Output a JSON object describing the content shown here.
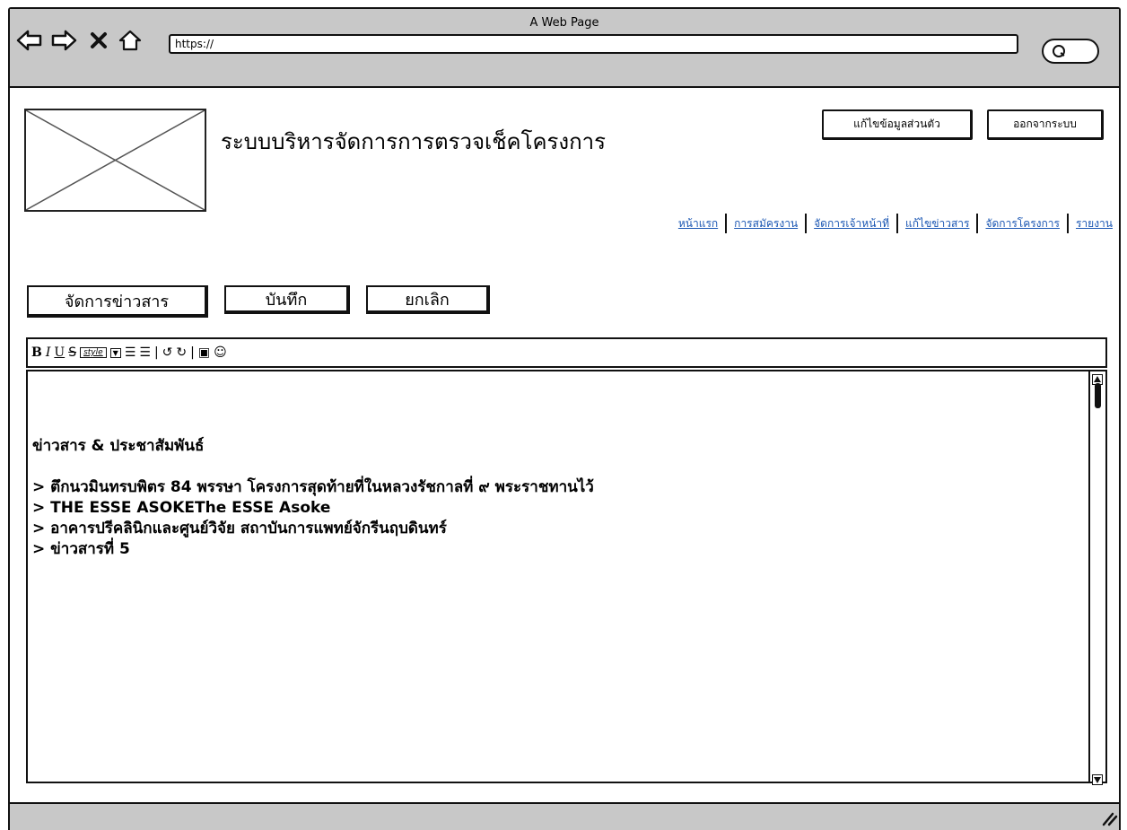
{
  "browser": {
    "window_title": "A Web Page",
    "url": "https://",
    "icons": [
      "back-arrow-icon",
      "forward-arrow-icon",
      "stop-icon",
      "home-icon",
      "search-icon"
    ]
  },
  "header": {
    "logo_placeholder": "image-placeholder",
    "title": "ระบบบริหารจัดการการตรวจเช็คโครงการ",
    "edit_profile_label": "แก้ไขข้อมูลส่วนตัว",
    "logout_label": "ออกจากระบบ"
  },
  "nav": {
    "items": [
      {
        "label": "หน้าแรก"
      },
      {
        "label": "การสมัครงาน"
      },
      {
        "label": "จัดการเจ้าหน้าที่"
      },
      {
        "label": "แก้ไขข่าวสาร"
      },
      {
        "label": "จัดการโครงการ"
      },
      {
        "label": "รายงาน"
      }
    ]
  },
  "actions": {
    "manage_news_label": "จัดการข่าวสาร",
    "save_label": "บันทึก",
    "cancel_label": "ยกเลิก"
  },
  "toolbar": {
    "bold": "B",
    "italic": "I",
    "underline": "U",
    "strike": "S",
    "style_label": "style",
    "style_arrow": "▼",
    "bullet_list": "☰",
    "numbered_list": "☰",
    "undo": "↺",
    "redo": "↻",
    "image": "▣",
    "emoji": "☺"
  },
  "editor": {
    "heading": "ข่าวสาร & ประชาสัมพันธ์",
    "lines": [
      "> ตึกนวมินทรบพิตร 84 พรรษา โครงการสุดท้ายที่ในหลวงรัชกาลที่ ๙ พระราชทานไว้",
      "> THE ESSE ASOKEThe ESSE Asoke",
      "> อาคารปรีคลินิกและศูนย์วิจัย สถาบันการแพทย์จักรีนฤบดินทร์",
      "> ข่าวสารที่ 5"
    ]
  },
  "colors": {
    "chrome_gray": "#c8c8c8",
    "link_blue": "#1a56b3",
    "border": "#111111"
  }
}
